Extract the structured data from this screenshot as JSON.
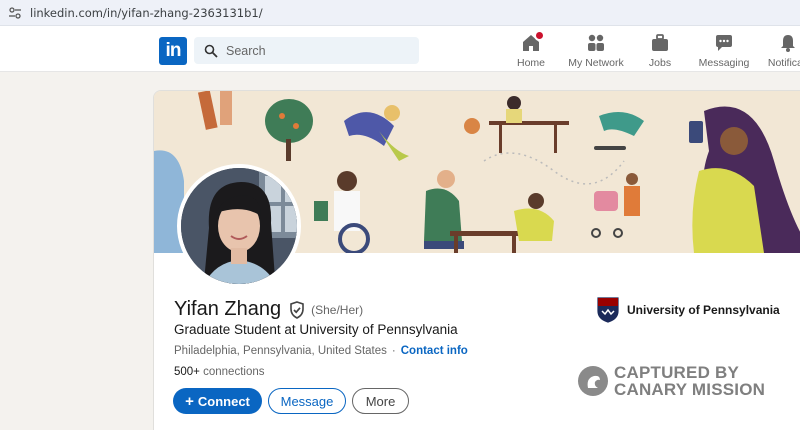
{
  "browser": {
    "url": "linkedin.com/in/yifan-zhang-2363131b1/"
  },
  "nav": {
    "logo": "in",
    "search_placeholder": "Search",
    "items": [
      {
        "label": "Home",
        "icon": "home-icon"
      },
      {
        "label": "My Network",
        "icon": "network-icon"
      },
      {
        "label": "Jobs",
        "icon": "briefcase-icon"
      },
      {
        "label": "Messaging",
        "icon": "messaging-icon"
      },
      {
        "label": "Notificati",
        "icon": "bell-icon"
      }
    ]
  },
  "profile": {
    "name": "Yifan Zhang",
    "pronouns": "(She/Her)",
    "headline": "Graduate Student at University of Pennsylvania",
    "location": "Philadelphia, Pennsylvania, United States",
    "separator": "·",
    "contact_info": "Contact info",
    "connections_count": "500+",
    "connections_label": "connections",
    "education": "University of Pennsylvania"
  },
  "actions": {
    "connect": "Connect",
    "message": "Message",
    "more": "More"
  },
  "watermark": {
    "line1": "CAPTURED BY",
    "line2": "CANARY MISSION"
  },
  "colors": {
    "brand": "#0a66c2",
    "badge": "#cb112d",
    "background": "#f4f2ee"
  }
}
